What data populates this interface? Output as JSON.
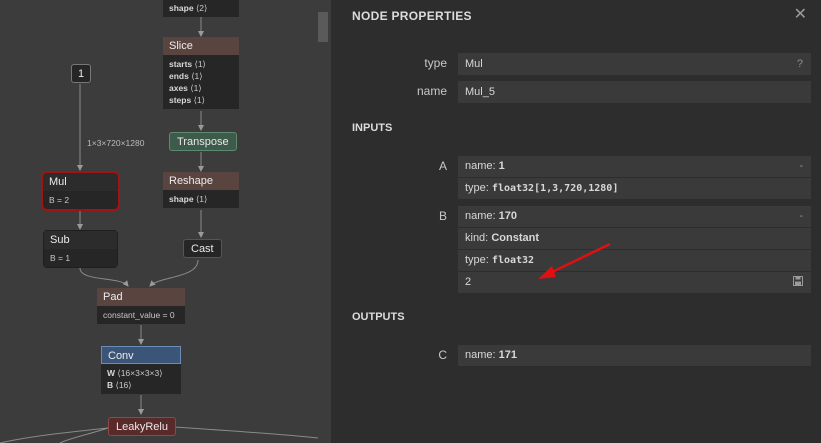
{
  "graph": {
    "nodes": {
      "top_attr": "shape ⟨2⟩",
      "slice": {
        "title": "Slice",
        "attrs": [
          "starts ⟨1⟩",
          "ends ⟨1⟩",
          "axes ⟨1⟩",
          "steps ⟨1⟩"
        ]
      },
      "const_input": "1",
      "edge_label": "1×3×720×1280",
      "transpose": "Transpose",
      "mul": {
        "title": "Mul",
        "attr": "B = 2"
      },
      "reshape": {
        "title": "Reshape",
        "attr": "shape ⟨1⟩"
      },
      "sub": {
        "title": "Sub",
        "attr": "B = 1"
      },
      "cast": "Cast",
      "pad": {
        "title": "Pad",
        "attr": "constant_value = 0"
      },
      "conv": {
        "title": "Conv",
        "attrs": [
          "W ⟨16×3×3×3⟩",
          "B ⟨16⟩"
        ]
      },
      "leakyrelu": "LeakyRelu"
    }
  },
  "panel": {
    "title": "NODE PROPERTIES",
    "close_icon": "close-icon",
    "type_label": "type",
    "type_value": "Mul",
    "type_help": "?",
    "name_label": "name",
    "name_value": "Mul_5",
    "inputs_heading": "INPUTS",
    "input_a": {
      "label": "A",
      "name_key": "name:",
      "name_val": "1",
      "type_key": "type:",
      "type_val": "float32[1,3,720,1280]",
      "toggle": "-"
    },
    "input_b": {
      "label": "B",
      "name_key": "name:",
      "name_val": "170",
      "kind_key": "kind:",
      "kind_val": "Constant",
      "type_key": "type:",
      "type_val": "float32",
      "value": "2",
      "toggle": "-",
      "save_icon": "save-icon"
    },
    "outputs_heading": "OUTPUTS",
    "output_c": {
      "label": "C",
      "name_key": "name:",
      "name_val": "171"
    }
  },
  "colors": {
    "selection": "#a01414",
    "annotation_arrow": "#e01010"
  }
}
